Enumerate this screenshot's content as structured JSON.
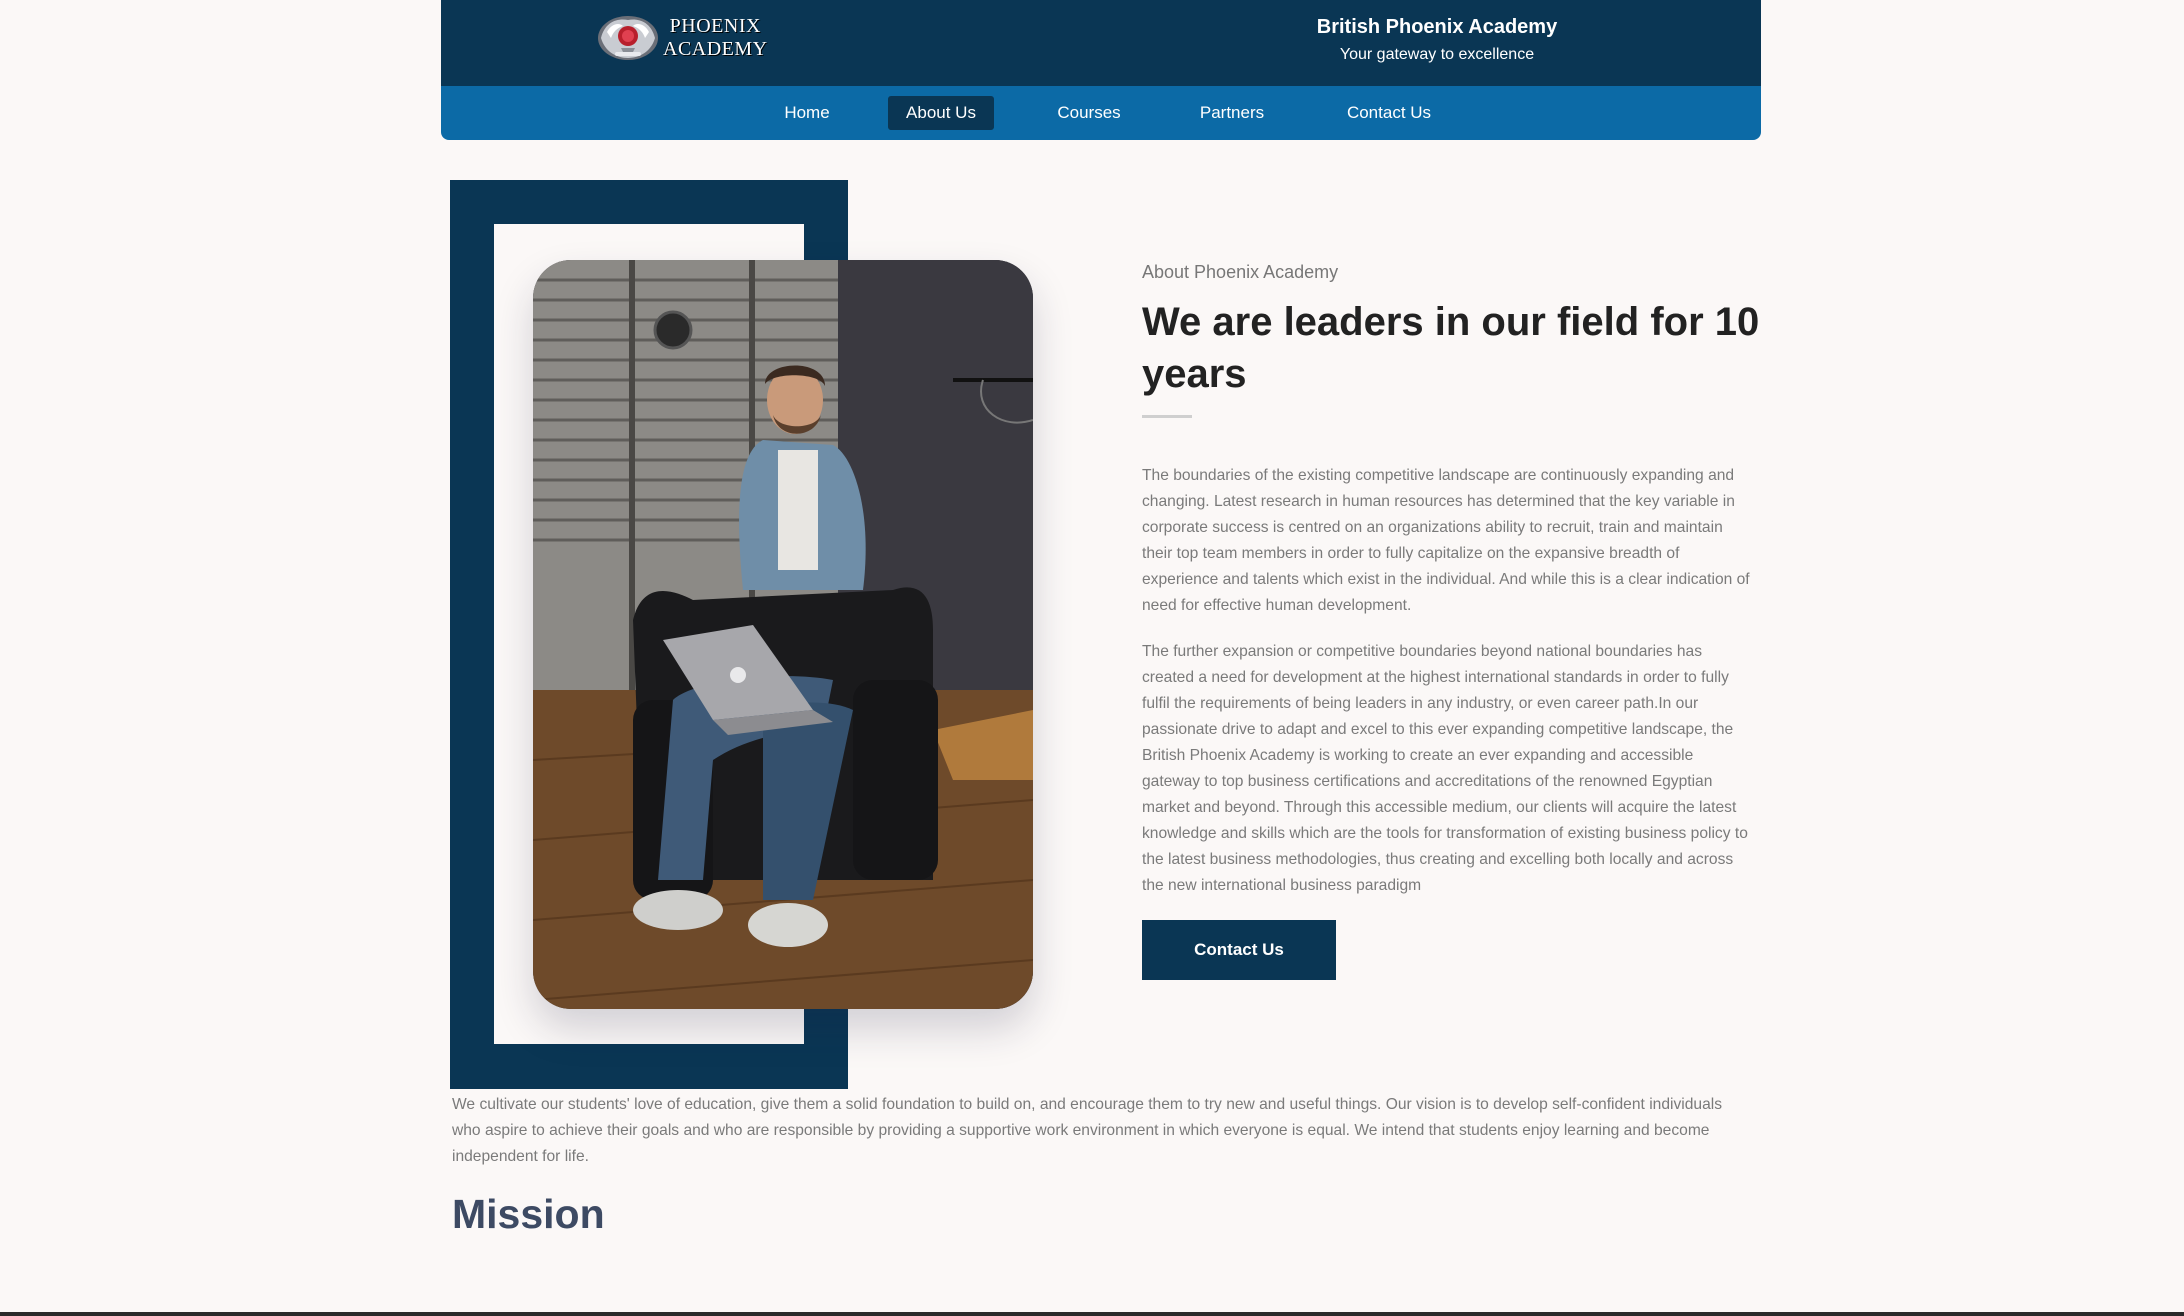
{
  "header": {
    "logo_line1": "PHOENIX",
    "logo_line2": "ACADEMY",
    "brand_title": "British Phoenix Academy",
    "brand_tagline": "Your gateway to excellence"
  },
  "nav": {
    "items": [
      {
        "label": "Home",
        "active": false
      },
      {
        "label": "About Us",
        "active": true
      },
      {
        "label": "Courses",
        "active": false
      },
      {
        "label": "Partners",
        "active": false
      },
      {
        "label": "Contact Us",
        "active": false
      }
    ]
  },
  "about": {
    "eyebrow": "About Phoenix Academy",
    "heading": "We are leaders in our field for 10 years",
    "paragraph1": "The boundaries of the existing competitive landscape are continuously expanding and changing. Latest research in human resources has determined that the key variable in corporate success is centred on an organizations ability to recruit, train and maintain their top team members in order to fully capitalize on the expansive breadth of experience and talents which exist in the individual. And while this is a clear indication of need for effective human development.",
    "paragraph2": "The further expansion or competitive boundaries beyond national boundaries has created a need for development at the highest international standards in order to fully fulfil the requirements of being leaders in any industry, or even career path.In our passionate drive to adapt and excel to this ever expanding competitive landscape, the British Phoenix Academy is working to create an ever expanding and accessible gateway to top business certifications and accreditations of the renowned Egyptian market and beyond. Through this accessible medium, our clients will acquire the latest knowledge and skills which are the tools for transformation of existing business policy to the latest business methodologies, thus creating and excelling both locally and across the new international business paradigm",
    "cta_label": "Contact Us"
  },
  "vision_text": "We cultivate our students' love of education, give them a solid foundation to build on, and encourage them to try new and useful things. Our vision is to develop self-confident individuals who aspire to achieve their goals and who are responsible by providing a supportive work environment in which everyone is equal. We intend that students enjoy learning and become independent for life.",
  "mission_heading": "Mission",
  "colors": {
    "navy": "#0a3654",
    "nav_blue": "#0c6aa6",
    "page_bg": "#fbf8f7",
    "body_text": "#7a7a7a",
    "heading_text": "#222222",
    "mission_text": "#3d4a63"
  },
  "icons": {
    "logo": "phoenix-crest-emblem"
  }
}
